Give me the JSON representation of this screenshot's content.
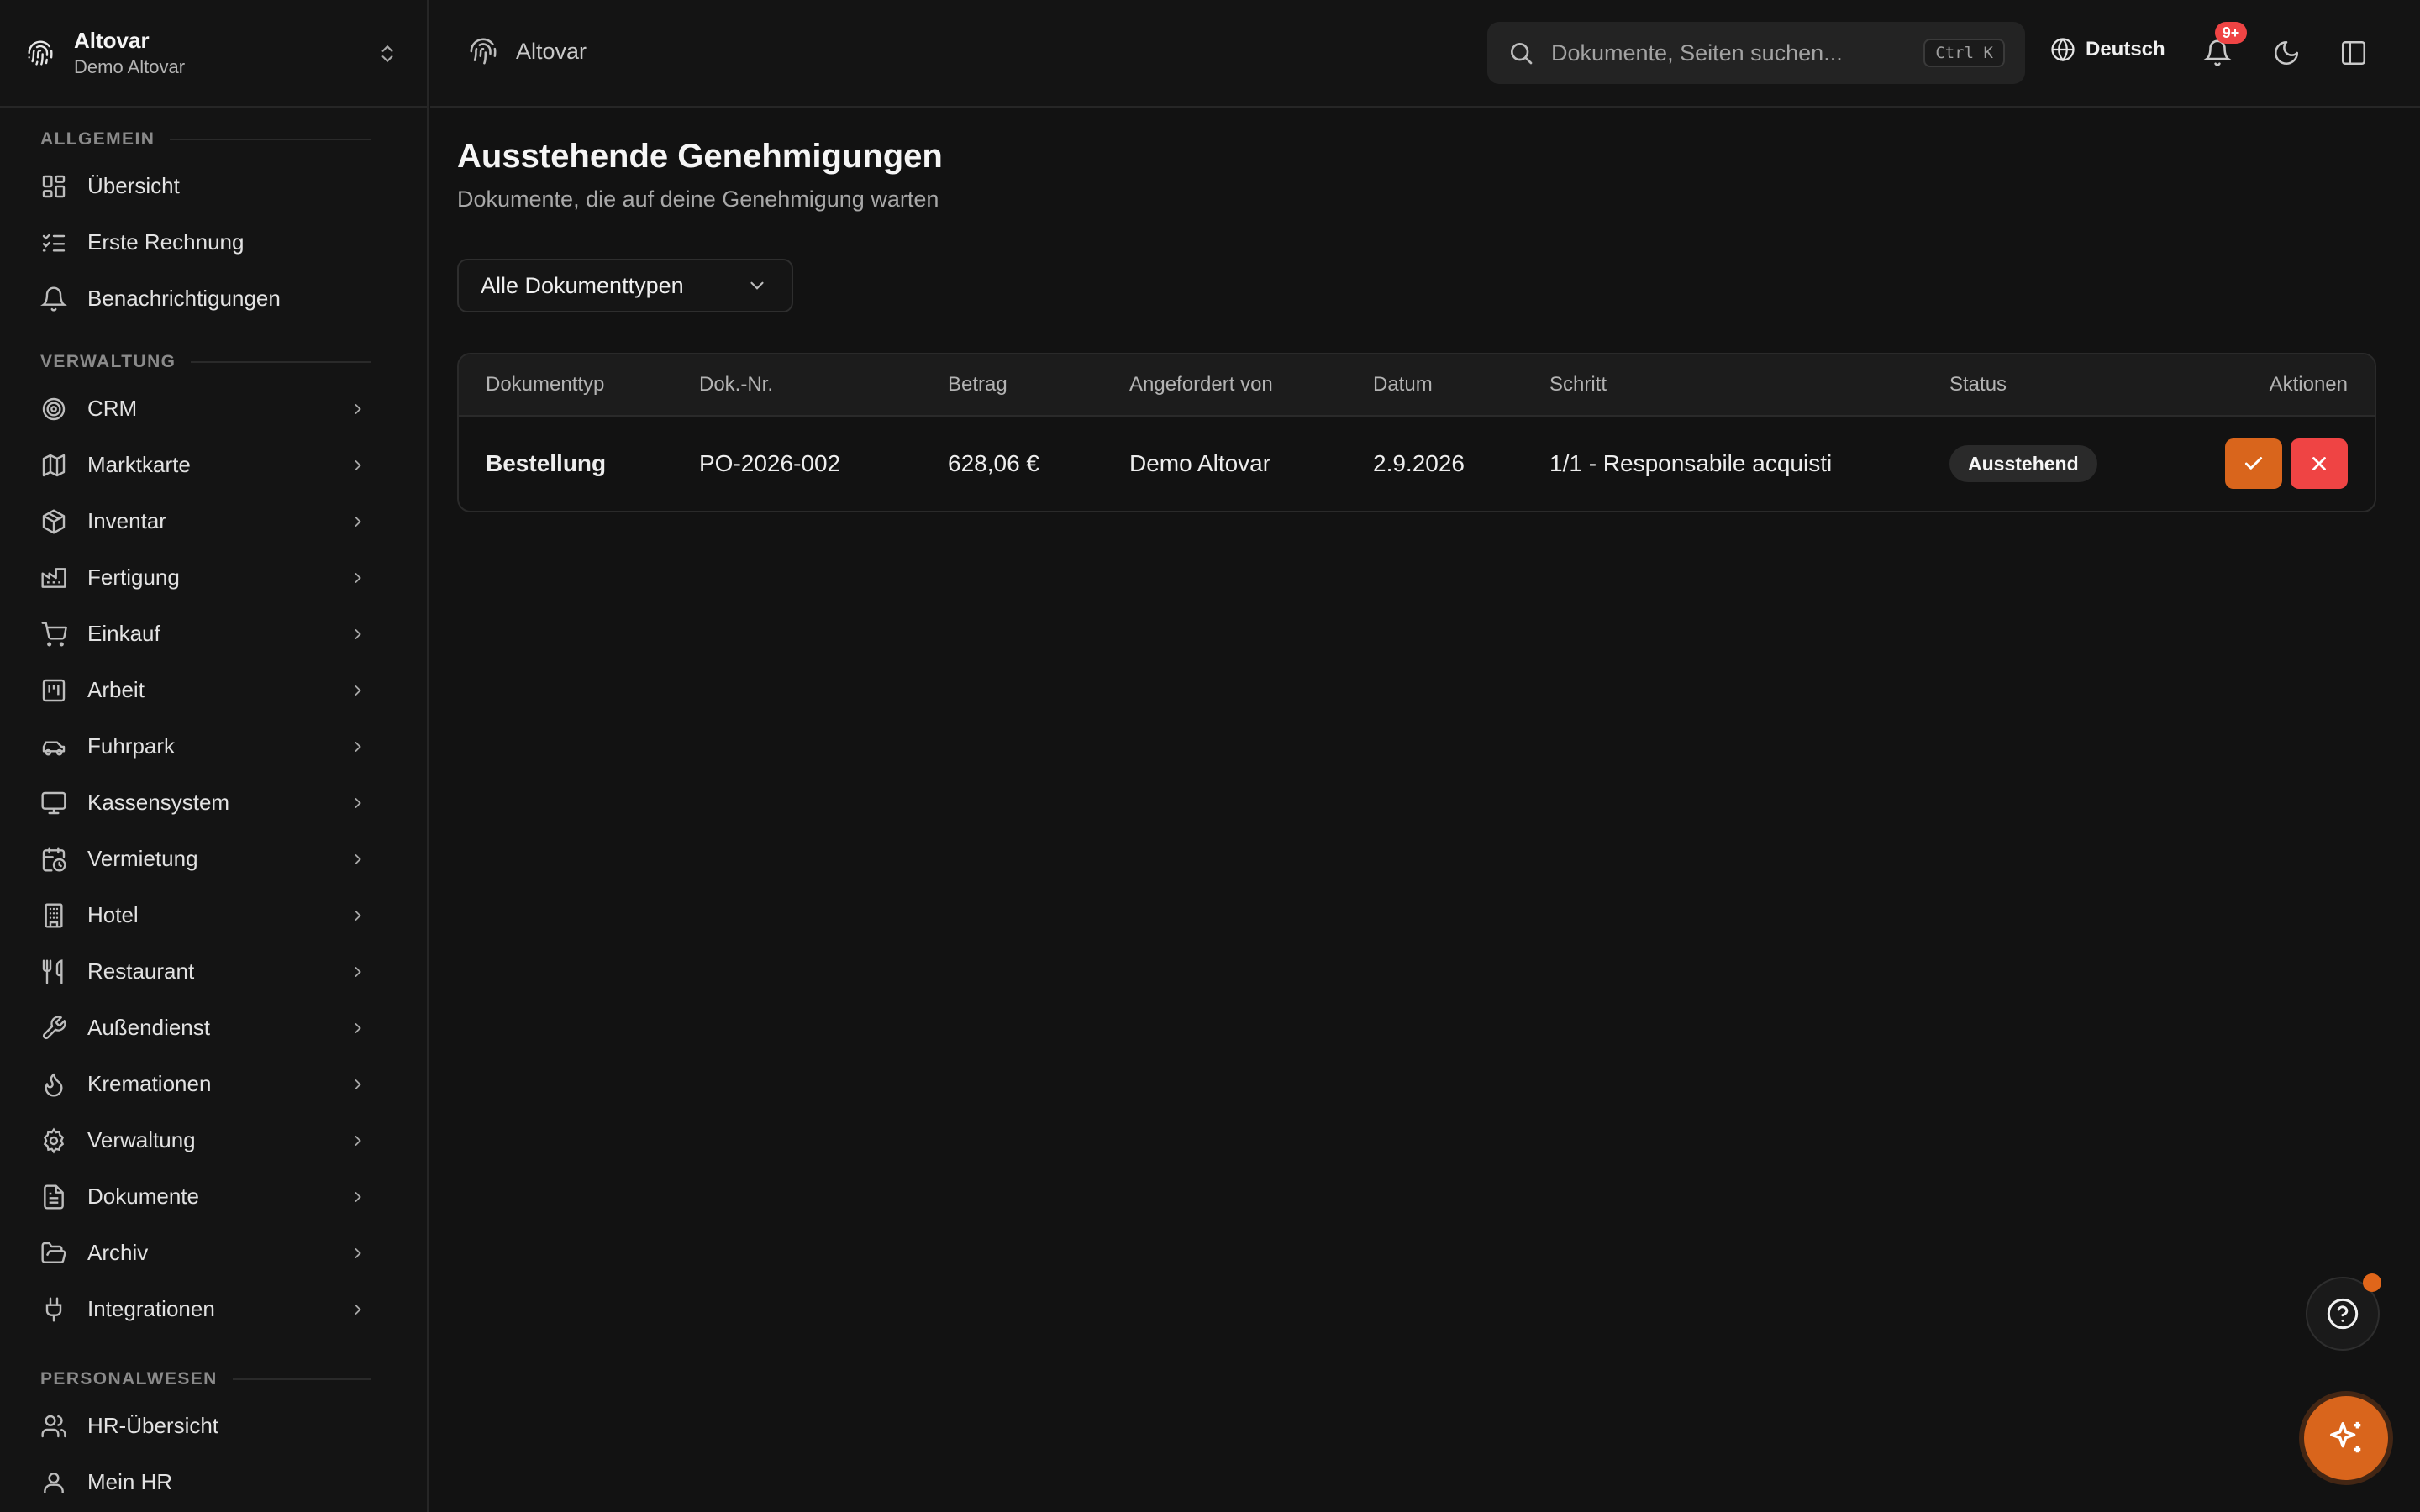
{
  "org": {
    "name": "Altovar",
    "subtitle": "Demo Altovar"
  },
  "sidebar": {
    "sections": [
      {
        "label": "ALLGEMEIN"
      },
      {
        "label": "VERWALTUNG"
      },
      {
        "label": "PERSONALWESEN"
      }
    ],
    "general": [
      {
        "label": "Übersicht",
        "icon": "dashboard-icon"
      },
      {
        "label": "Erste Rechnung",
        "icon": "checklist-icon"
      },
      {
        "label": "Benachrichtigungen",
        "icon": "bell-icon"
      }
    ],
    "admin": [
      {
        "label": "CRM",
        "icon": "target-icon"
      },
      {
        "label": "Marktkarte",
        "icon": "map-icon"
      },
      {
        "label": "Inventar",
        "icon": "package-icon"
      },
      {
        "label": "Fertigung",
        "icon": "factory-icon"
      },
      {
        "label": "Einkauf",
        "icon": "cart-icon"
      },
      {
        "label": "Arbeit",
        "icon": "kanban-icon"
      },
      {
        "label": "Fuhrpark",
        "icon": "car-icon"
      },
      {
        "label": "Kassensystem",
        "icon": "monitor-icon"
      },
      {
        "label": "Vermietung",
        "icon": "calendar-clock-icon"
      },
      {
        "label": "Hotel",
        "icon": "building-icon"
      },
      {
        "label": "Restaurant",
        "icon": "utensils-icon"
      },
      {
        "label": "Außendienst",
        "icon": "wrench-icon"
      },
      {
        "label": "Kremationen",
        "icon": "flame-icon"
      },
      {
        "label": "Verwaltung",
        "icon": "gear-icon"
      },
      {
        "label": "Dokumente",
        "icon": "file-icon"
      },
      {
        "label": "Archiv",
        "icon": "folder-open-icon"
      },
      {
        "label": "Integrationen",
        "icon": "plug-icon"
      }
    ],
    "hr": [
      {
        "label": "HR-Übersicht",
        "icon": "users-icon"
      },
      {
        "label": "Mein HR",
        "icon": "user-icon"
      }
    ]
  },
  "topbar": {
    "breadcrumb": "Altovar",
    "search_placeholder": "Dokumente, Seiten suchen...",
    "shortcut": "Ctrl K",
    "language": "Deutsch",
    "notification_count": "9+"
  },
  "page": {
    "title": "Ausstehende Genehmigungen",
    "subtitle": "Dokumente, die auf deine Genehmigung warten",
    "filter_value": "Alle Dokumenttypen"
  },
  "table": {
    "columns": [
      "Dokumenttyp",
      "Dok.-Nr.",
      "Betrag",
      "Angefordert von",
      "Datum",
      "Schritt",
      "Status",
      "Aktionen"
    ],
    "rows": [
      {
        "type": "Bestellung",
        "number": "PO-2026-002",
        "amount": "628,06 €",
        "requested_by": "Demo Altovar",
        "date": "2.9.2026",
        "step": "1/1 - Responsabile acquisti",
        "status": "Ausstehend"
      }
    ]
  },
  "colors": {
    "accent": "#d9651c",
    "danger": "#ef4444",
    "background": "#121212"
  }
}
